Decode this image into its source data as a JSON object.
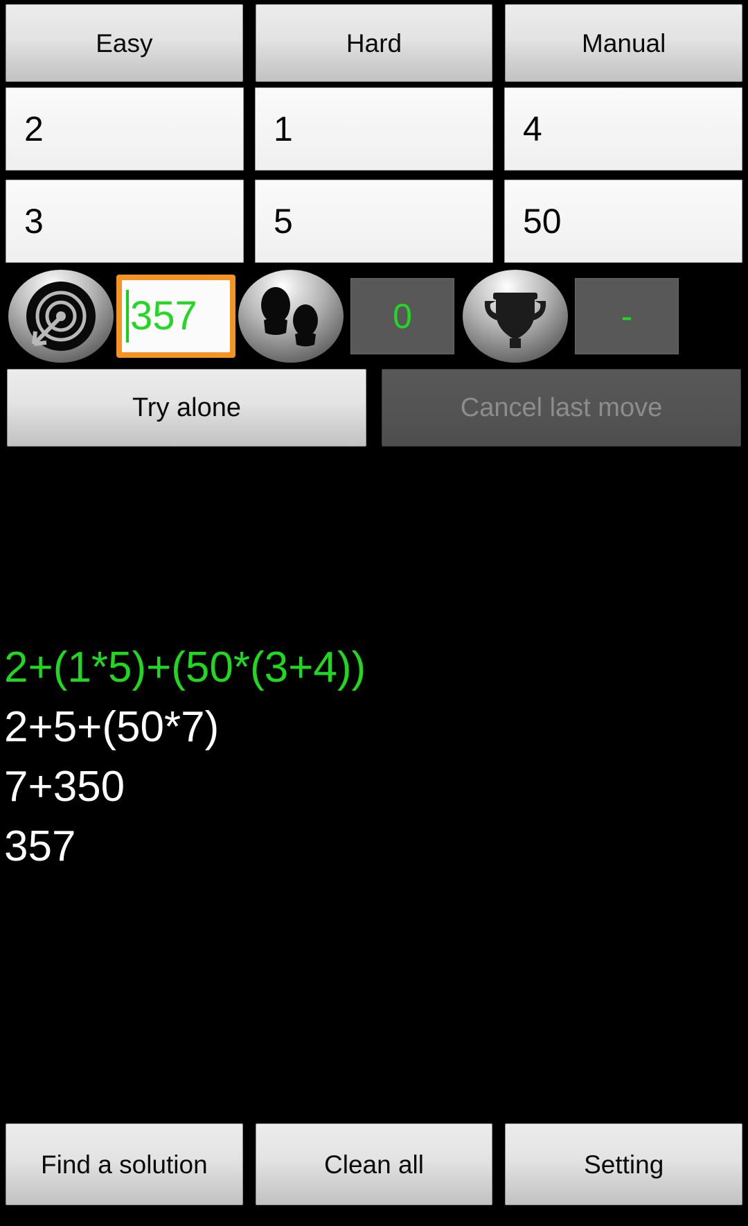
{
  "modes": [
    {
      "label": "Easy",
      "name": "mode-easy"
    },
    {
      "label": "Hard",
      "name": "mode-hard"
    },
    {
      "label": "Manual",
      "name": "mode-manual"
    }
  ],
  "numbers": {
    "row1": [
      "2",
      "1",
      "4"
    ],
    "row2": [
      "3",
      "5",
      "50"
    ]
  },
  "status": {
    "target_icon": "target-bullseye-icon",
    "target_value": "357",
    "moves_icon": "footprints-icon",
    "moves_value": "0",
    "best_icon": "trophy-icon",
    "best_value": "-"
  },
  "actions": {
    "try_alone": "Try alone",
    "cancel_last_move": "Cancel last move"
  },
  "solution": {
    "lines": [
      {
        "text": "2+(1*5)+(50*(3+4))",
        "color": "green"
      },
      {
        "text": "2+5+(50*7)",
        "color": "white"
      },
      {
        "text": "7+350",
        "color": "white"
      },
      {
        "text": "357",
        "color": "white"
      }
    ]
  },
  "bottom": [
    {
      "label": "Find a solution",
      "name": "find-a-solution-button"
    },
    {
      "label": "Clean all",
      "name": "clean-all-button"
    },
    {
      "label": "Setting",
      "name": "setting-button"
    }
  ],
  "colors": {
    "accent_orange": "#f39423",
    "green_text": "#23d723",
    "background": "#000000"
  }
}
